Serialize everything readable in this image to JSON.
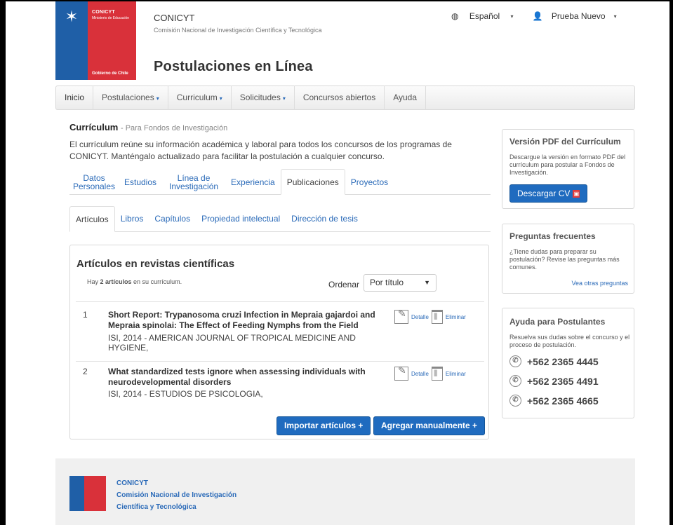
{
  "header": {
    "logo_org": "CONICYT",
    "logo_ministry": "Ministerio de Educación",
    "logo_gov": "Gobierno de Chile",
    "brand_title": "CONICYT",
    "brand_subtitle": "Comisión Nacional de Investigación Científica y Tecnológica",
    "app_title": "Postulaciones en Línea",
    "language": "Español",
    "user": "Prueba Nuevo"
  },
  "nav": {
    "items": [
      {
        "label": "Inicio"
      },
      {
        "label": "Postulaciones",
        "dropdown": true
      },
      {
        "label": "Curriculum",
        "dropdown": true
      },
      {
        "label": "Solicitudes",
        "dropdown": true
      },
      {
        "label": "Concursos abiertos"
      },
      {
        "label": "Ayuda"
      }
    ]
  },
  "curriculum": {
    "heading": "Currículum",
    "heading_sub": "- Para Fondos de Investigación",
    "description": "El currículum reúne su información académica y laboral para todos los concursos de los programas de CONICYT. Manténgalo actualizado para facilitar la postulación a cualquier concurso.",
    "tabs": [
      {
        "label": "Datos Personales"
      },
      {
        "label": "Estudios"
      },
      {
        "label": "Línea de Investigación"
      },
      {
        "label": "Experiencia"
      },
      {
        "label": "Publicaciones",
        "active": true
      },
      {
        "label": "Proyectos"
      }
    ],
    "subtabs": [
      {
        "label": "Artículos",
        "active": true
      },
      {
        "label": "Libros"
      },
      {
        "label": "Capítulos"
      },
      {
        "label": "Propiedad intelectual"
      },
      {
        "label": "Dirección de tesis"
      }
    ]
  },
  "panel": {
    "title": "Artículos en revistas científicas",
    "count_prefix": "Hay ",
    "count_bold": "2 artículos",
    "count_suffix": " en su currículum.",
    "order_label": "Ordenar",
    "order_value": "Por título",
    "articles": [
      {
        "num": "1",
        "title": "Short Report: Trypanosoma cruzi Infection in Mepraia gajardoi and Mepraia spinolai: The Effect of Feeding Nymphs from the Field",
        "meta": "ISI, 2014 - AMERICAN JOURNAL OF TROPICAL MEDICINE AND HYGIENE,"
      },
      {
        "num": "2",
        "title": "What standardized tests ignore when assessing individuals with neurodevelopmental disorders",
        "meta": "ISI, 2014 - ESTUDIOS DE PSICOLOGIA,"
      }
    ],
    "detail_label": "Detalle",
    "delete_label": "Eliminar",
    "import_button": "Importar artículos +",
    "add_button": "Agregar manualmente +"
  },
  "sidebar": {
    "pdf": {
      "title": "Versión PDF del Currículum",
      "text": "Descargue la versión en formato PDF del currículum para postular a Fondos de Investigación.",
      "button": "Descargar CV"
    },
    "faq": {
      "title": "Preguntas frecuentes",
      "text": "¿Tiene dudas para preparar su postulación? Revise las preguntas más comunes.",
      "link": "Vea otras preguntas"
    },
    "help": {
      "title": "Ayuda para Postulantes",
      "text": "Resuelva sus dudas sobre el concurso y el proceso de postulación.",
      "phones": [
        "+562 2365 4445",
        "+562 2365 4491",
        "+562 2365 4665"
      ]
    }
  },
  "footer": {
    "line1": "CONICYT",
    "line2": "Comisión Nacional de Investigación",
    "line3": "Científica y Tecnológica"
  },
  "colors": {
    "accent_blue": "#1f6bbf",
    "link_blue": "#2a6ab8",
    "logo_red": "#d9313a",
    "logo_blue": "#1f5fa7"
  }
}
